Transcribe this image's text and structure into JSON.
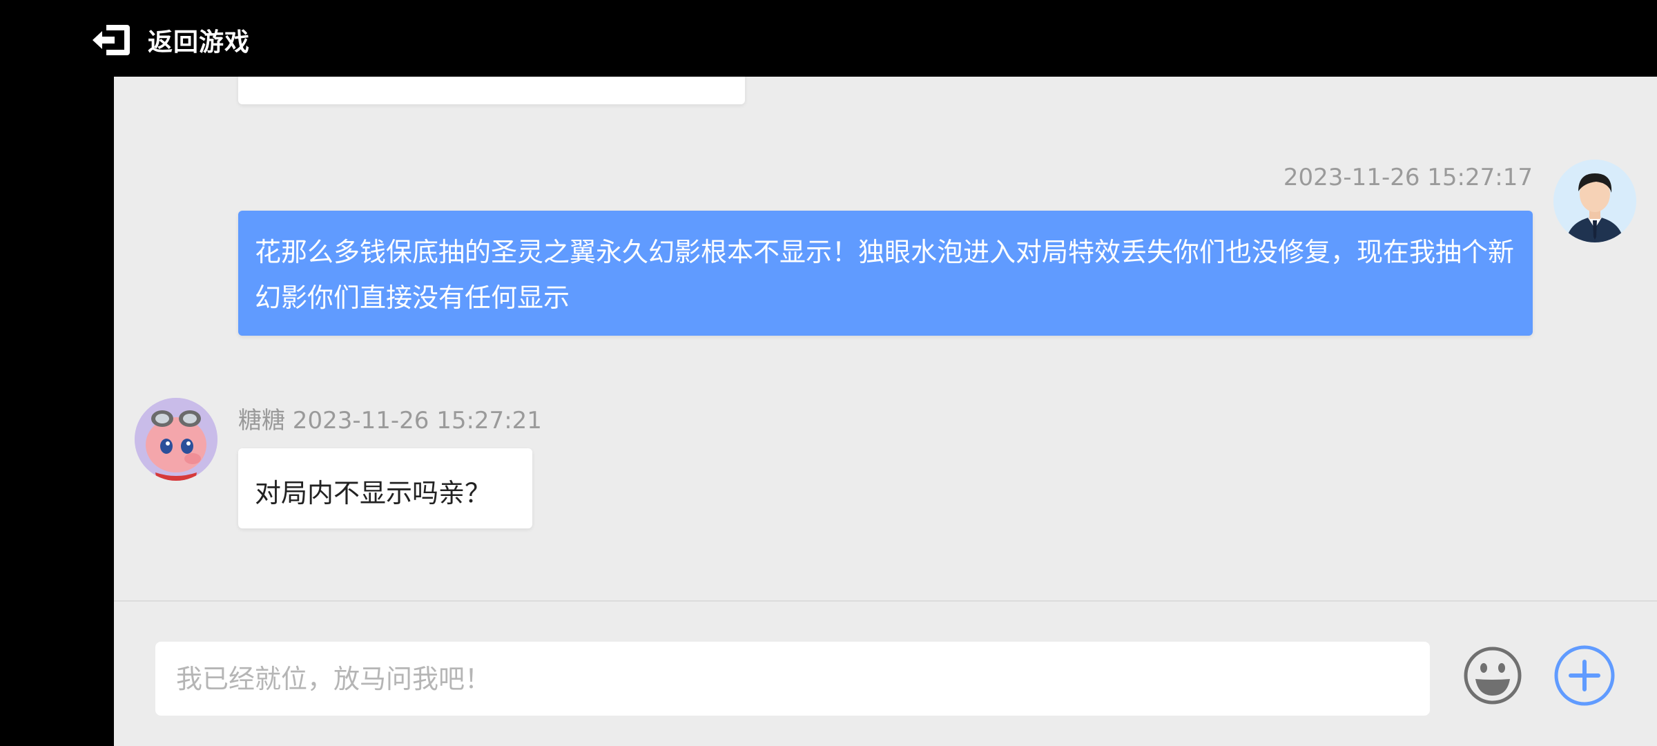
{
  "header": {
    "back_label": "返回游戏",
    "back_icon": "exit-icon"
  },
  "messages": {
    "mine": {
      "timestamp": "2023-11-26 15:27:17",
      "text": "花那么多钱保底抽的圣灵之翼永久幻影根本不显示！独眼水泡进入对局特效丢失你们也没修复，现在我抽个新幻影你们直接没有任何显示"
    },
    "reply": {
      "meta": "糖糖 2023-11-26 15:27:21",
      "text": "对局内不显示吗亲？"
    }
  },
  "composer": {
    "placeholder": "我已经就位，放马问我吧！",
    "value": "",
    "emoji_icon": "emoji-icon",
    "plus_icon": "plus-icon"
  },
  "colors": {
    "accent": "#609bff",
    "chat_bg": "#ececec",
    "header_bg": "#000000"
  }
}
